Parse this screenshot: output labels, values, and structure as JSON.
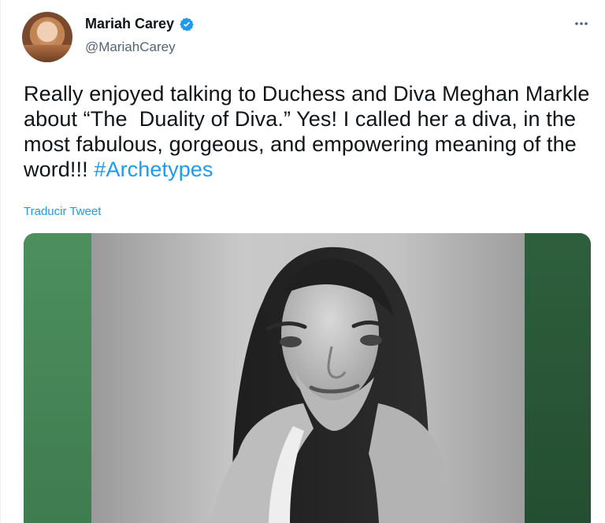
{
  "user": {
    "display_name": "Mariah Carey",
    "handle": "@MariahCarey",
    "verified": true
  },
  "tweet": {
    "text": "Really enjoyed talking to Duchess and Diva Meghan Markle about “The  Duality of Diva.” Yes! I called her a diva, in the most fabulous, gorgeous, and empowering meaning of the word!!!",
    "hashtag": "#Archetypes",
    "translate_label": "Traducir Tweet"
  },
  "media": {
    "description": "",
    "colors": {
      "left_green": "#4d8f5e",
      "right_green": "#2e5f3d",
      "background_gray": "#c9c9c9"
    }
  },
  "icons": {
    "verified": "verified-badge-icon",
    "more": "more-options-icon"
  },
  "colors": {
    "link": "#1d9bf0",
    "text": "#0f1419",
    "secondary_text": "#536471"
  }
}
